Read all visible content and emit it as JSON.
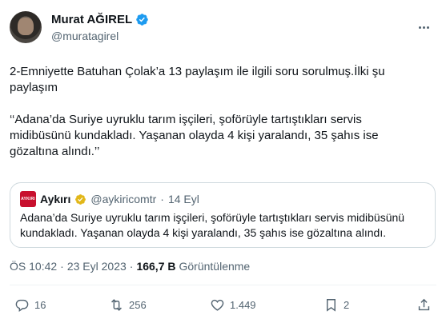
{
  "author": {
    "name": "Murat AĞIREL",
    "handle": "@muratagirel"
  },
  "tweet": {
    "text": "2-Emniyette Batuhan Çolak’a 13 paylaşım ile ilgili soru sorulmuş.İlki şu\npaylaşım\n\n‘‘Adana’da Suriye uyruklu tarım işçileri, şoförüyle tartıştıkları servis\nmidibüsünü kundakladı. Yaşanan olayda 4 kişi yaralandı, 35 şahıs ise\ngözaltına alındı.’’"
  },
  "quote": {
    "logo_text": "AYKIRI",
    "name": "Aykırı",
    "handle": "@aykiricomtr",
    "dot": "·",
    "date": "14 Eyl",
    "text": "Adana’da Suriye uyruklu tarım işçileri, şoförüyle tartıştıkları servis midibüsünü kundakladı. Yaşanan olayda 4 kişi yaralandı, 35 şahıs ise gözaltına alındı."
  },
  "meta": {
    "time": "ÖS 10:42",
    "dot": "·",
    "date": "23 Eyl 2023",
    "dot2": "·",
    "views": "166,7 B",
    "views_label": "Görüntülenme"
  },
  "actions": {
    "replies": "16",
    "retweets": "256",
    "likes": "1.449",
    "bookmarks": "2"
  },
  "colors": {
    "verified_blue": "#1d9bf0",
    "verified_gold": "#e2b719",
    "brand_red": "#c8102e"
  }
}
